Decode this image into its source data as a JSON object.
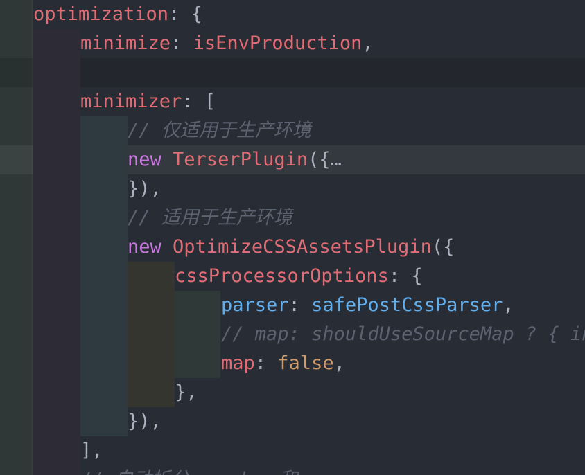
{
  "editor": {
    "theme": {
      "background": "#282c34",
      "keyword": "#c678dd",
      "property": "#e06c75",
      "blue": "#61afef",
      "orange": "#d19a66",
      "comment": "#5c6370"
    },
    "lines": {
      "l1": {
        "key": "optimization",
        "punc": ": {"
      },
      "l2": {
        "key": "minimize",
        "punc": ": ",
        "val": "isEnvProduction",
        "end": ","
      },
      "l4": {
        "key": "minimizer",
        "punc": ": ["
      },
      "l5": {
        "comment": "// 仅适用于生产环境"
      },
      "l6": {
        "kw": "new",
        "cls": "TerserPlugin",
        "punc": "({",
        "fold": "…"
      },
      "l7": {
        "punc": "}),"
      },
      "l8": {
        "comment": "// 适用于生产环境"
      },
      "l9": {
        "kw": "new",
        "cls": "OptimizeCSSAssetsPlugin",
        "punc": "({"
      },
      "l10": {
        "key": "cssProcessorOptions",
        "punc": ": {"
      },
      "l11": {
        "key": "parser",
        "punc": ": ",
        "val": "safePostCssParser",
        "end": ","
      },
      "l12": {
        "comment": "// map: shouldUseSourceMap ? { inline: false, annotation: true } : false,"
      },
      "l13": {
        "key": "map",
        "punc": ": ",
        "val": "false",
        "end": ","
      },
      "l14": {
        "punc": "},"
      },
      "l15": {
        "punc": "}),"
      },
      "l16": {
        "punc": "],"
      },
      "l17": {
        "comment": "// 自动拆分 vendor 和 commons"
      }
    }
  }
}
